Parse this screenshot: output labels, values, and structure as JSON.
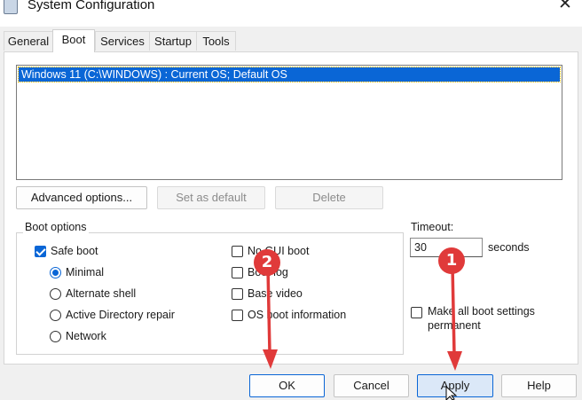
{
  "window": {
    "title": "System Configuration",
    "close_glyph": "✕"
  },
  "tabs": [
    {
      "label": "General",
      "active": false
    },
    {
      "label": "Boot",
      "active": true
    },
    {
      "label": "Services",
      "active": false
    },
    {
      "label": "Startup",
      "active": false
    },
    {
      "label": "Tools",
      "active": false
    }
  ],
  "os_list": {
    "items": [
      "Windows 11 (C:\\WINDOWS) : Current OS; Default OS"
    ],
    "selected_index": 0
  },
  "os_buttons": {
    "advanced": "Advanced options...",
    "set_default": "Set as default",
    "delete": "Delete"
  },
  "boot_options": {
    "title": "Boot options",
    "safe_boot": {
      "label": "Safe boot",
      "checked": true
    },
    "safe_boot_modes": [
      {
        "label": "Minimal",
        "checked": true
      },
      {
        "label": "Alternate shell",
        "checked": false
      },
      {
        "label": "Active Directory repair",
        "checked": false
      },
      {
        "label": "Network",
        "checked": false
      }
    ],
    "right_options": [
      {
        "label": "No GUI boot",
        "checked": false
      },
      {
        "label": "Boot log",
        "checked": false
      },
      {
        "label": "Base video",
        "checked": false
      },
      {
        "label": "OS boot information",
        "checked": false
      }
    ]
  },
  "timeout": {
    "label": "Timeout:",
    "value": "30",
    "unit": "seconds"
  },
  "permanent": {
    "label_line1": "Make all boot settings",
    "label_line2": "permanent",
    "checked": false
  },
  "dialog_buttons": {
    "ok": "OK",
    "cancel": "Cancel",
    "apply": "Apply",
    "help": "Help"
  },
  "annotations": {
    "marker_1": "1",
    "marker_2": "2",
    "color": "#e03a3a"
  },
  "colors": {
    "accent": "#0a66d6",
    "annotation": "#e03a3a"
  }
}
